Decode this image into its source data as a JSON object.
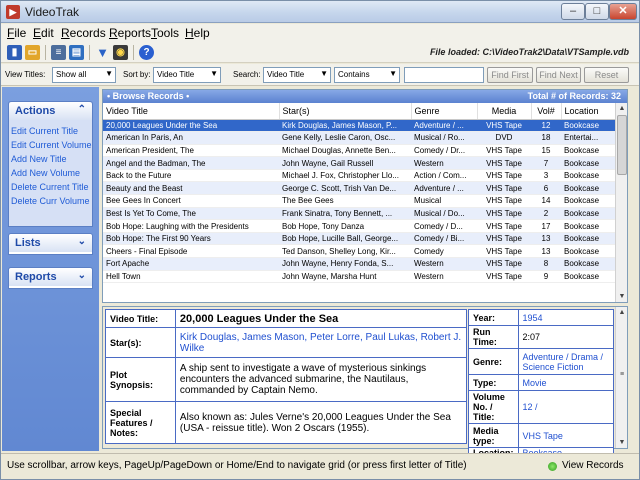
{
  "app": {
    "title": "VideoTrak"
  },
  "menu": [
    "File",
    "Edit",
    "Records",
    "Reports",
    "Tools",
    "Help"
  ],
  "toolbar": {
    "file_loaded": "File loaded: C:\\VideoTrak2\\Data\\VTSample.vdb"
  },
  "filter": {
    "view_titles_label": "View Titles:",
    "view_titles_value": "Show all",
    "sort_by_label": "Sort by:",
    "sort_by_value": "Video Title",
    "search_label": "Search:",
    "search_field_value": "Video Title",
    "search_mode_value": "Contains",
    "search_text": "",
    "find_first": "Find First",
    "find_next": "Find Next",
    "reset": "Reset"
  },
  "sidebar": {
    "actions_title": "Actions",
    "actions": [
      "Edit Current Title",
      "Edit Current Volume",
      "Add New Title",
      "Add New Volume",
      "Delete Current Title",
      "Delete Curr Volume"
    ],
    "lists_title": "Lists",
    "reports_title": "Reports"
  },
  "grid": {
    "header": "• Browse Records •",
    "total": "Total # of Records: 32",
    "columns": [
      "Video Title",
      "Star(s)",
      "Genre",
      "Media",
      "Vol#",
      "Location"
    ],
    "rows": [
      [
        "20,000 Leagues Under the Sea",
        "Kirk Douglas, James Mason, P...",
        "Adventure / ...",
        "VHS Tape",
        "12",
        "Bookcase"
      ],
      [
        "American In Paris, An",
        "Gene Kelly, Leslie Caron, Osc...",
        "Musical / Ro...",
        "DVD",
        "18",
        "Entertai..."
      ],
      [
        "American President, The",
        "Michael Douglas, Annette Ben...",
        "Comedy / Dr...",
        "VHS Tape",
        "15",
        "Bookcase"
      ],
      [
        "Angel and the Badman, The",
        "John Wayne, Gail Russell",
        "Western",
        "VHS Tape",
        "7",
        "Bookcase"
      ],
      [
        "Back to the Future",
        "Michael J. Fox, Christopher Llo...",
        "Action / Com...",
        "VHS Tape",
        "3",
        "Bookcase"
      ],
      [
        "Beauty and the Beast",
        "George C. Scott, Trish Van De...",
        "Adventure / ...",
        "VHS Tape",
        "6",
        "Bookcase"
      ],
      [
        "Bee Gees In Concert",
        "The Bee Gees",
        "Musical",
        "VHS Tape",
        "14",
        "Bookcase"
      ],
      [
        "Best Is Yet To Come, The",
        "Frank Sinatra, Tony Bennett, ...",
        "Musical / Do...",
        "VHS Tape",
        "2",
        "Bookcase"
      ],
      [
        "Bob Hope: Laughing with the Presidents",
        "Bob Hope, Tony Danza",
        "Comedy / D...",
        "VHS Tape",
        "17",
        "Bookcase"
      ],
      [
        "Bob Hope: The First 90 Years",
        "Bob Hope, Lucille Ball, George...",
        "Comedy / Bi...",
        "VHS Tape",
        "13",
        "Bookcase"
      ],
      [
        "Cheers - Final Episode",
        "Ted Danson, Shelley Long, Kir...",
        "Comedy",
        "VHS Tape",
        "13",
        "Bookcase"
      ],
      [
        "Fort Apache",
        "John Wayne, Henry Fonda, S...",
        "Western",
        "VHS Tape",
        "8",
        "Bookcase"
      ],
      [
        "Hell Town",
        "John Wayne, Marsha Hunt",
        "Western",
        "VHS Tape",
        "9",
        "Bookcase"
      ]
    ]
  },
  "detail": {
    "video_title_label": "Video Title:",
    "video_title": "20,000 Leagues Under the Sea",
    "stars_label": "Star(s):",
    "stars": "Kirk Douglas, James Mason, Peter Lorre, Paul Lukas, Robert J. Wilke",
    "plot_label": "Plot Synopsis:",
    "plot": "A ship sent to investigate a wave of mysterious sinkings encounters the advanced submarine, the Nautilaus, commanded by Captain Nemo.",
    "special_label": "Special Features / Notes:",
    "special": "Also known as: Jules Verne's 20,000 Leagues Under the Sea (USA - reissue title). Won 2 Oscars (1955).",
    "year_label": "Year:",
    "year": "1954",
    "runtime_label": "Run Time:",
    "runtime": "2:07",
    "genre_label": "Genre:",
    "genre": "Adventure / Drama / Science Fiction",
    "type_label": "Type:",
    "type": "Movie",
    "volume_label": "Volume No. / Title:",
    "volume": "12 /",
    "media_label": "Media type:",
    "media": "VHS Tape",
    "location_label": "Location:",
    "location": "Bookcase"
  },
  "status": {
    "hint": "Use scrollbar, arrow keys, PageUp/PageDown or Home/End to navigate grid (or press first letter of Title)",
    "mode": "View Records"
  }
}
